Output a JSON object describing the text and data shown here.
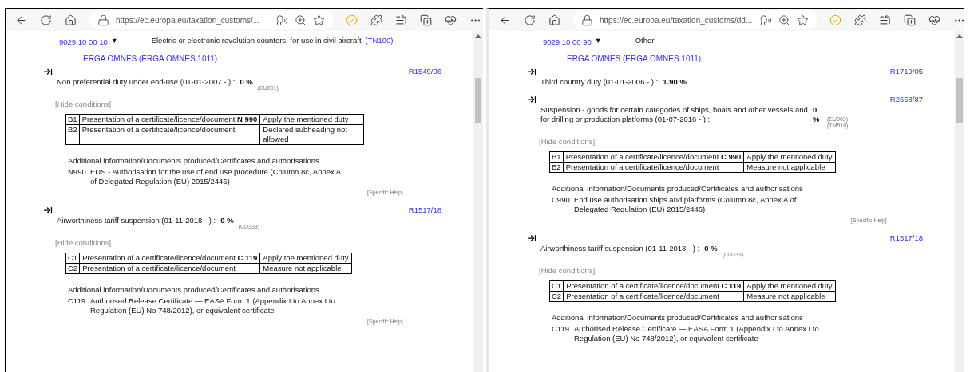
{
  "windows": [
    {
      "url": "https://ec.europa.eu/taxation_customs/...",
      "code": "9029 10 00 10",
      "toggle": "▼",
      "dashes": "- -",
      "description": "Electric or electronic revolution counters, for use in civil aircraft",
      "note": "(TN100)",
      "origin": "ERGA OMNES (ERGA OMNES 1011)",
      "measures": [
        {
          "regulation": "R1549/06",
          "text": "Non preferential duty under end-use (01-01-2007 - ) :",
          "rate": "0 %",
          "footnotes": [
            "(EU001)"
          ],
          "conditions_link": "[Hide conditions]",
          "conditions": [
            {
              "code": "B1",
              "text": "Presentation of a certificate/licence/document **N 990**",
              "action": "Apply the mentioned duty"
            },
            {
              "code": "B2",
              "text": "Presentation of a certificate/licence/document",
              "action": "Declared subheading not allowed"
            }
          ],
          "additional_title": "Additional information/Documents produced/Certificates and authorisations",
          "additional": [
            {
              "code": "N990",
              "text": "EUS - Authorisation for the use of end use procedure (Column 8c, Annex A of Delegated Regulation (EU) 2015/2446)"
            }
          ],
          "help": "[Specific Help]"
        },
        {
          "regulation": "R1517/18",
          "text": "Airworthiness tariff suspension (01-11-2018 - ) :",
          "rate": "0 %",
          "footnotes": [
            "(CD333)"
          ],
          "conditions_link": "[Hide conditions]",
          "conditions": [
            {
              "code": "C1",
              "text": "Presentation of a certificate/licence/document **C 119**",
              "action": "Apply the mentioned duty"
            },
            {
              "code": "C2",
              "text": "Presentation of a certificate/licence/document",
              "action": "Measure not applicable"
            }
          ],
          "additional_title": "Additional information/Documents produced/Certificates and authorisations",
          "additional": [
            {
              "code": "C119",
              "text": "Authorised Release Certificate — EASA Form 1 (Appendix I to Annex I to Regulation (EU) No 748/2012), or equivalent certificate"
            }
          ],
          "help": "[Specific Help]"
        }
      ]
    },
    {
      "url": "https://ec.europa.eu/taxation_customs/dd...",
      "code": "9029 10 00 90",
      "toggle": "▼",
      "dashes": "- -",
      "description": "Other",
      "origin": "ERGA OMNES (ERGA OMNES 1011)",
      "measures": [
        {
          "regulation": "R1719/05",
          "text": "Third country duty (01-01-2006 - ) :",
          "rate": "1.90 %"
        },
        {
          "regulation": "R2658/87",
          "text": "Suspension - goods for certain categories of ships, boats and other vessels and for drilling or production platforms (01-07-2016 - ) :",
          "rate": "0 %",
          "footnotes": [
            "(EU003)",
            "(TM510)"
          ],
          "conditions_link": "[Hide conditions]",
          "conditions": [
            {
              "code": "B1",
              "text": "Presentation of a certificate/licence/document **C 990**",
              "action": "Apply the mentioned duty"
            },
            {
              "code": "B2",
              "text": "Presentation of a certificate/licence/document",
              "action": "Measure not applicable"
            }
          ],
          "additional_title": "Additional information/Documents produced/Certificates and authorisations",
          "additional": [
            {
              "code": "C990",
              "text": "End use authorisation ships and platforms (Column 8c, Annex A of Delegated Regulation (EU) 2015/2446)"
            }
          ],
          "help": "[Specific Help]"
        },
        {
          "regulation": "R1517/18",
          "text": "Airworthiness tariff suspension (01-11-2018 - ) :",
          "rate": "0 %",
          "footnotes": [
            "(CD333)"
          ],
          "conditions_link": "[Hide conditions]",
          "conditions": [
            {
              "code": "C1",
              "text": "Presentation of a certificate/licence/document **C 119**",
              "action": "Apply the mentioned duty"
            },
            {
              "code": "C2",
              "text": "Presentation of a certificate/licence/document",
              "action": "Measure not applicable"
            }
          ],
          "additional_title": "Additional information/Documents produced/Certificates and authorisations",
          "additional": [
            {
              "code": "C119",
              "text": "Authorised Release Certificate — EASA Form 1 (Appendix I to Annex I to Regulation (EU) No 748/2012), or equivalent certificate"
            }
          ]
        }
      ]
    }
  ]
}
